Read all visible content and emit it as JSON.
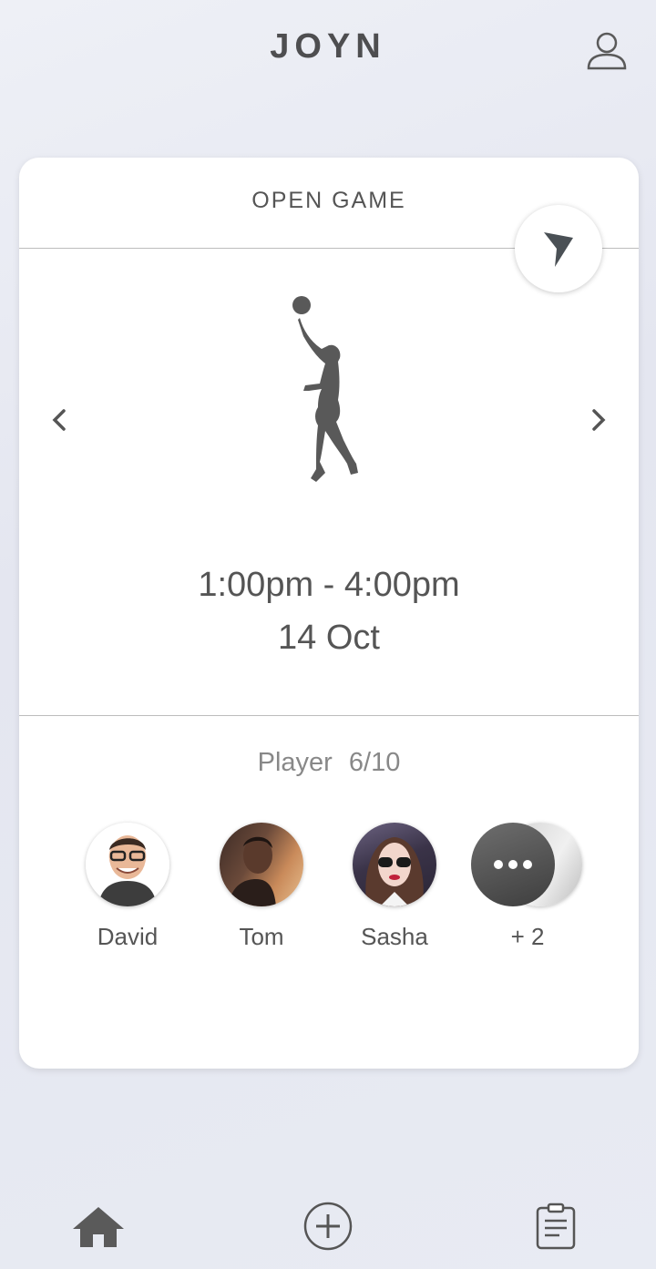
{
  "header": {
    "app_title": "JOYN",
    "profile_icon": "user-icon"
  },
  "card": {
    "title": "OPEN GAME",
    "nav_icon": "navigation-arrow-icon",
    "sport_icon": "basketball-player-icon",
    "time_range": "1:00pm - 4:00pm",
    "date": "14 Oct",
    "players_label": "Player",
    "players_count": "6/10",
    "players": [
      {
        "name": "David",
        "avatar": "avatar-david"
      },
      {
        "name": "Tom",
        "avatar": "avatar-tom"
      },
      {
        "name": "Sasha",
        "avatar": "avatar-sasha"
      }
    ],
    "more_label": "+ 2"
  },
  "tabbar": {
    "items": [
      {
        "icon": "home-icon"
      },
      {
        "icon": "add-circle-icon"
      },
      {
        "icon": "clipboard-icon"
      }
    ]
  },
  "colors": {
    "accent": "#4e4e50",
    "card_bg": "#ffffff",
    "page_bg": "#e8eaf2"
  }
}
